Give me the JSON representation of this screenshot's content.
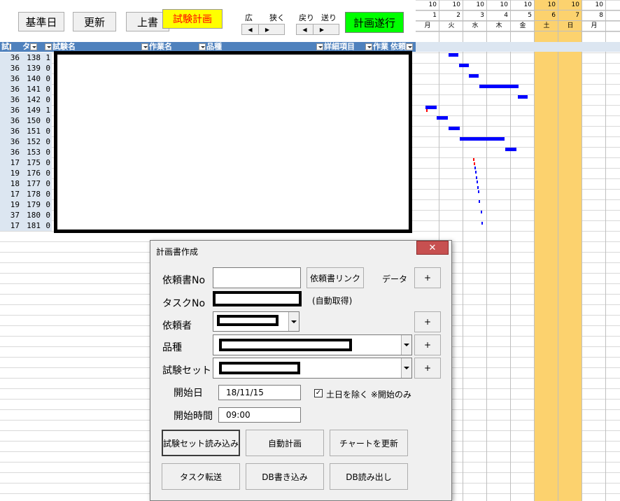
{
  "toolbar": {
    "base_date": "基準日",
    "refresh": "更新",
    "overwrite": "上書",
    "test_plan": "試験計画",
    "plan_execute": "計画遂行",
    "wide": "広",
    "narrow": "狭く",
    "back": "戻り",
    "forward": "送り",
    "left_arrow": "◀",
    "right_arrow": "▶"
  },
  "table": {
    "headers": [
      "試",
      "タ",
      "試験名",
      "作業名",
      "品種",
      "詳細項目",
      "作業",
      "依頼"
    ],
    "rows": [
      [
        "36",
        "138",
        "1"
      ],
      [
        "36",
        "139",
        "0"
      ],
      [
        "36",
        "140",
        "0"
      ],
      [
        "36",
        "141",
        "0"
      ],
      [
        "36",
        "142",
        "0"
      ],
      [
        "36",
        "149",
        "1"
      ],
      [
        "36",
        "150",
        "0"
      ],
      [
        "36",
        "151",
        "0"
      ],
      [
        "36",
        "152",
        "0"
      ],
      [
        "36",
        "153",
        "0"
      ],
      [
        "17",
        "175",
        "0"
      ],
      [
        "19",
        "176",
        "0"
      ],
      [
        "18",
        "177",
        "0"
      ],
      [
        "17",
        "178",
        "0"
      ],
      [
        "19",
        "179",
        "0"
      ],
      [
        "37",
        "180",
        "0"
      ],
      [
        "17",
        "181",
        "0"
      ]
    ]
  },
  "chart": {
    "months": [
      "10",
      "10",
      "10",
      "10",
      "10",
      "10",
      "10",
      "10"
    ],
    "days": [
      "1",
      "2",
      "3",
      "4",
      "5",
      "6",
      "7",
      "8"
    ],
    "weekdays": [
      "月",
      "火",
      "水",
      "木",
      "金",
      "土",
      "日",
      "月"
    ],
    "weekend_color": "#fcd26e",
    "bar_color": "#0000ff"
  },
  "dialog": {
    "title": "計画書作成",
    "close": "✕",
    "request_no_label": "依頼書No",
    "request_link": "依頼書リンク",
    "data_label": "データ",
    "plus": "+",
    "task_no_label": "タスクNo",
    "auto_fetch": "(自動取得)",
    "requester_label": "依頼者",
    "product_label": "品種",
    "test_set_label": "試験セット",
    "start_date_label": "開始日",
    "start_date_value": "18/11/15",
    "exclude_weekend": "土日を除く ※開始のみ",
    "check_mark": "✓",
    "start_time_label": "開始時間",
    "start_time_value": "09:00",
    "load_test_set": "試験セット読み込み",
    "auto_plan": "自動計画",
    "update_chart": "チャートを更新",
    "task_transfer": "タスク転送",
    "db_write": "DB書き込み",
    "db_read": "DB読み出し"
  }
}
